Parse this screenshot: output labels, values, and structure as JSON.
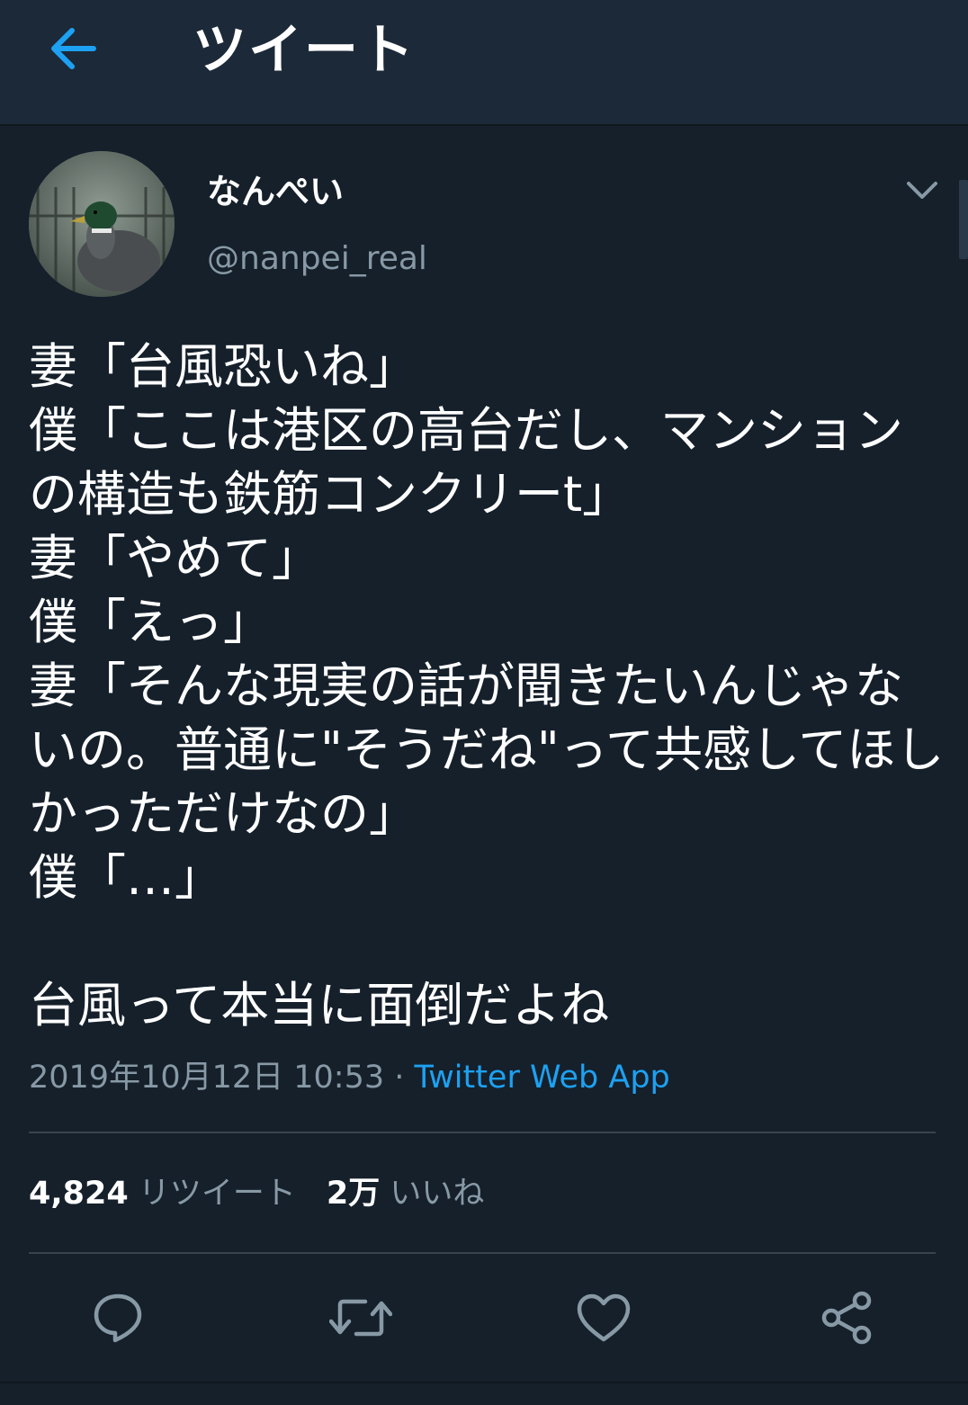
{
  "header": {
    "title": "ツイート",
    "back_icon": "arrow-left-icon"
  },
  "colors": {
    "background": "#15202b",
    "header": "#1c2938",
    "accent": "#1da1f2",
    "secondary_text": "#8899a6",
    "divider": "#38444d"
  },
  "tweet": {
    "author": {
      "display_name": "なんぺい",
      "handle": "@nanpei_real"
    },
    "text": "妻「台風恐いね」\n僕「ここは港区の高台だし、マンションの構造も鉄筋コンクリーt」\n妻「やめて」\n僕「えっ」\n妻「そんな現実の話が聞きたいんじゃないの。普通に\"そうだね\"って共感してほしかっただけなの」\n僕「…」\n\n台風って本当に面倒だよね",
    "timestamp": "2019年10月12日 10:53",
    "separator": " · ",
    "source": "Twitter Web App"
  },
  "stats": {
    "retweets": {
      "count": "4,824",
      "label": "リツイート"
    },
    "likes": {
      "count": "2万",
      "label": "いいね"
    }
  },
  "actions": [
    {
      "name": "reply",
      "icon": "reply-icon"
    },
    {
      "name": "retweet",
      "icon": "retweet-icon"
    },
    {
      "name": "like",
      "icon": "heart-icon"
    },
    {
      "name": "share",
      "icon": "share-icon"
    }
  ]
}
